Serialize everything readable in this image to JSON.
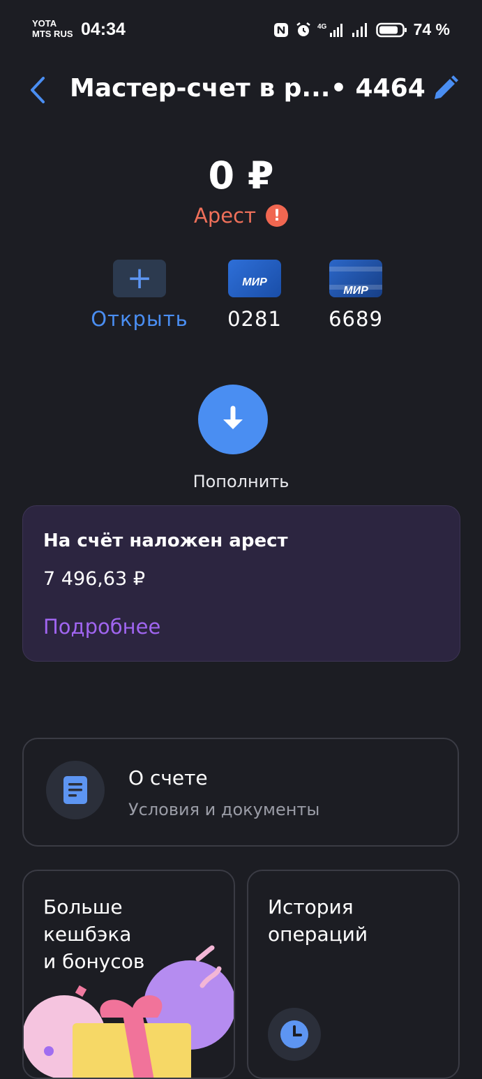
{
  "status_bar": {
    "carrier_1": "YOTA",
    "carrier_2": "MTS RUS",
    "time": "04:34",
    "battery": "74 %",
    "icons": [
      "nfc-icon",
      "alarm-icon",
      "signal-4g-icon",
      "signal-icon",
      "battery-icon"
    ]
  },
  "header": {
    "title": "Мастер-счет в р...",
    "account_number": "• 4464"
  },
  "balance": {
    "amount": "0 ₽",
    "status": "Арест"
  },
  "cards": [
    {
      "label": "Открыть",
      "icon": "plus-icon"
    },
    {
      "label": "0281",
      "brand": "МИР"
    },
    {
      "label": "6689",
      "brand": "МИР"
    }
  ],
  "topup": {
    "label": "Пополнить"
  },
  "arrest": {
    "title": "На счёт наложен арест",
    "amount": "7 496,63 ₽",
    "link": "Подробнее"
  },
  "about": {
    "title": "О счете",
    "subtitle": "Условия и документы"
  },
  "tiles": {
    "cashback_line1": "Больше",
    "cashback_line2": "кешбэка",
    "cashback_line3": "и бонусов",
    "history_line1": "История",
    "history_line2": "операций"
  },
  "colors": {
    "background": "#1c1d23",
    "accent_blue": "#4a8ef2",
    "warning_red": "#f0705a",
    "arrest_panel": "#2c2540",
    "link_purple": "#a065f0"
  }
}
